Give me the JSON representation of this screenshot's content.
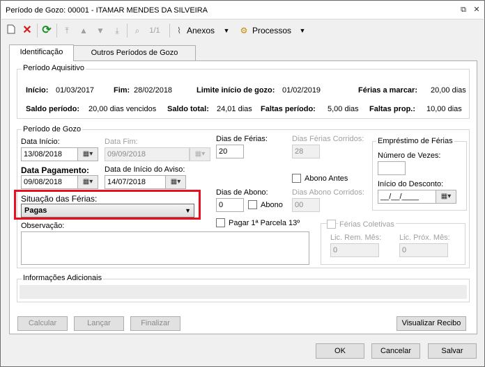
{
  "window": {
    "title": "Período de Gozo: 00001 - ITAMAR MENDES DA SILVEIRA",
    "restore_label": "⧉",
    "close_label": "✕"
  },
  "toolbar": {
    "page_counter": "1/1",
    "anexos_label": "Anexos",
    "processos_label": "Processos"
  },
  "tabs": [
    {
      "label": "Identificação"
    },
    {
      "label": "Outros Períodos de Gozo"
    }
  ],
  "periodo_aquisitivo": {
    "title": "Período Aquisitivo",
    "inicio_label": "Início:",
    "inicio_value": "01/03/2017",
    "fim_label": "Fim:",
    "fim_value": "28/02/2018",
    "limite_label": "Limite início de gozo:",
    "limite_value": "01/02/2019",
    "ferias_marcar_label": "Férias a marcar:",
    "ferias_marcar_value": "20,00 dias",
    "saldo_periodo_label": "Saldo período:",
    "saldo_periodo_value": "20,00 dias vencidos",
    "saldo_total_label": "Saldo total:",
    "saldo_total_value": "24,01 dias",
    "faltas_periodo_label": "Faltas período:",
    "faltas_periodo_value": "5,00 dias",
    "faltas_prop_label": "Faltas prop.:",
    "faltas_prop_value": "10,00 dias"
  },
  "periodo_gozo": {
    "title": "Período de Gozo",
    "data_inicio_label": "Data Início:",
    "data_inicio_value": "13/08/2018",
    "data_fim_label": "Data Fim:",
    "data_fim_value": "09/09/2018",
    "data_pagamento_label": "Data Pagamento:",
    "data_pagamento_value": "09/08/2018",
    "data_aviso_label": "Data de Início do Aviso:",
    "data_aviso_value": "14/07/2018",
    "dias_ferias_label": "Dias de Férias:",
    "dias_ferias_value": "20",
    "dias_corridos_label": "Dias Férias Corridos:",
    "dias_corridos_value": "28",
    "abono_antes_label": "Abono Antes",
    "situacao_label": "Situação das Férias:",
    "situacao_value": "Pagas",
    "dias_abono_label": "Dias de Abono:",
    "dias_abono_value": "0",
    "abono_label": "Abono",
    "dias_abono_corridos_label": "Dias Abono Corridos:",
    "dias_abono_corridos_value": "00",
    "observacao_label": "Observação:",
    "pagar_13_label": "Pagar 1ª Parcela 13º"
  },
  "emprestimo": {
    "title": "Empréstimo de Férias",
    "numero_vezes_label": "Número de Vezes:",
    "numero_vezes_value": "",
    "inicio_desconto_label": "Início do Desconto:",
    "inicio_desconto_value": "__/__/____"
  },
  "ferias_coletivas": {
    "label": "Férias Coletivas",
    "lic_rem_label": "Lic. Rem. Mês:",
    "lic_rem_value": "0",
    "lic_prox_label": "Lic. Próx. Mês:",
    "lic_prox_value": "0"
  },
  "info_adicionais": {
    "title": "Informações Adicionais"
  },
  "actions": {
    "calcular": "Calcular",
    "lancar": "Lançar",
    "finalizar": "Finalizar",
    "visualizar_recibo": "Visualizar Recibo"
  },
  "footer": {
    "ok": "OK",
    "cancelar": "Cancelar",
    "salvar": "Salvar"
  }
}
